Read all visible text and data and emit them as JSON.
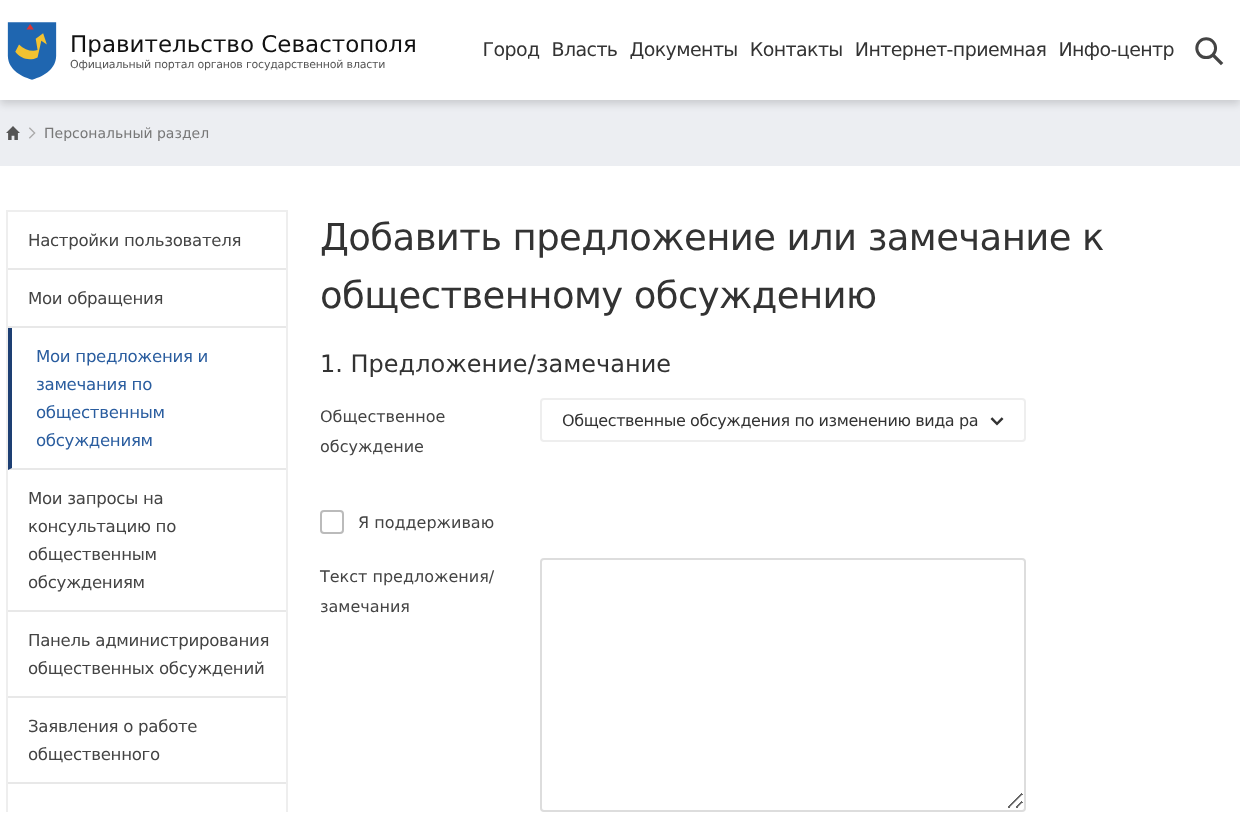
{
  "header": {
    "title": "Правительство Севастополя",
    "subtitle": "Официальный портал органов государственной власти",
    "nav": [
      "Город",
      "Власть",
      "Документы",
      "Контакты",
      "Интернет-приемная",
      "Инфо-центр"
    ]
  },
  "breadcrumb": [
    "Персональный раздел"
  ],
  "sidebar": {
    "items": [
      {
        "label": "Настройки пользователя",
        "selected": false
      },
      {
        "label": "Мои обращения",
        "selected": false
      },
      {
        "label": "Мои предложения и замечания по общественным обсуждениям",
        "selected": true
      },
      {
        "label": "Мои запросы на консультацию по общественным обсуждениям",
        "selected": false
      },
      {
        "label": "Панель администрирования общественных обсуждений",
        "selected": false
      },
      {
        "label": "Заявления о работе общественного",
        "selected": false
      }
    ]
  },
  "content": {
    "title": "Добавить предложение или замечание к общественному обсуждению",
    "section": "1. Предложение/замечание",
    "discussion_label": "Общественное обсуждение",
    "discussion_value": "Общественные обсуждения по изменению вида ра",
    "support": {
      "label": "Я поддерживаю",
      "checked": false
    },
    "text_label": "Текст предложения/ замечания"
  }
}
